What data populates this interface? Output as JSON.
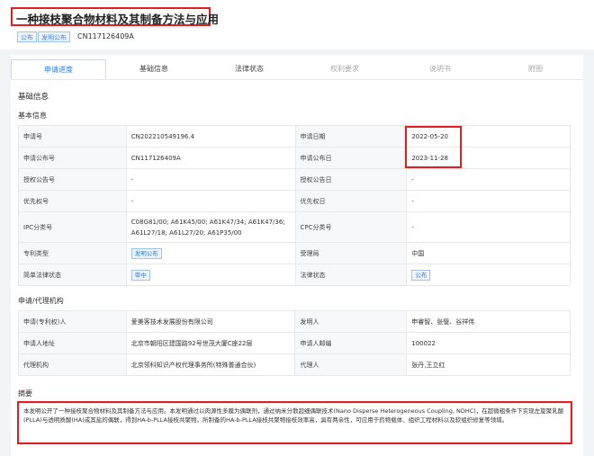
{
  "patent": {
    "title": "一种接枝聚合物材料及其制备方法与应用",
    "tags": [
      "公布",
      "发明公布"
    ],
    "pub_no": "CN117126409A"
  },
  "tabs": [
    {
      "label": "申请进度",
      "state": "active"
    },
    {
      "label": "基础信息",
      "state": "normal"
    },
    {
      "label": "法律状态",
      "state": "normal"
    },
    {
      "label": "权利要求",
      "state": "disabled"
    },
    {
      "label": "说明书",
      "state": "disabled"
    },
    {
      "label": "附图",
      "state": "disabled"
    }
  ],
  "basic_info": {
    "section_title": "基础信息",
    "sub_title": "基本信息",
    "labels": {
      "app_no": "申请号",
      "app_date": "申请日期",
      "pub_no": "申请公布号",
      "pub_date": "申请公布日",
      "grant_no": "授权公告号",
      "grant_date": "授权公告日",
      "priority_no": "优先权号",
      "priority_date": "优先权日",
      "ipc": "IPC分类号",
      "cpc": "CPC分类号",
      "type": "专利类型",
      "office": "受理局",
      "simple_status": "简单法律状态",
      "legal_status": "法律状态"
    },
    "values": {
      "app_no": "CN202210549196.4",
      "app_date": "2022-05-20",
      "pub_no": "CN117126409A",
      "pub_date": "2023-11-28",
      "grant_no": "-",
      "grant_date": "-",
      "priority_no": "-",
      "priority_date": "-",
      "ipc": "C08G81/00; A61K45/00; A61K47/34; A61K47/36; A61L27/18; A61L27/20; A61P35/00",
      "cpc": "-",
      "type": "发明公布",
      "office": "中国",
      "simple_status": "审中",
      "legal_status": "公布"
    }
  },
  "applicant": {
    "section_title": "申请/代理机构",
    "labels": {
      "applicant": "申请(专利权)人",
      "inventor": "发明人",
      "address": "申请人地址",
      "postcode": "申请人邮编",
      "agency": "代理机构",
      "agent": "代理人"
    },
    "values": {
      "applicant": "爱美客技术发展股份有限公司",
      "inventor": "申睿智、张璧、谷祥伟",
      "address": "北京市朝阳区建国路92号世茂大厦C座22层",
      "postcode": "100022",
      "agency": "北京领科知识产权代理事务所(特殊普通合伙)",
      "agent": "张丹,王立红"
    }
  },
  "abstract": {
    "title": "摘要",
    "text": "本发明公开了一种接枝聚合物材料及其制备方法与应用。本发明通过以肉源性多膜为偶联剂，通过纳米分散超细偶联技术(Nano Disperse Heterogeneous Coupling, NDHC)，在超微粗条件下实现左旋聚乳酸(PLLA)与透明质酸(HA)或其盐的偶联，得到HA-b-PLLA接枝共聚物。所制备的HA-b-PLLA接枝共聚物接枝效率高，具有两亲性，可应用于药物载体、组织工程材料以及软组织修复等领域。"
  },
  "colors": {
    "highlight": "#e02020",
    "accent": "#2d7ae0"
  }
}
